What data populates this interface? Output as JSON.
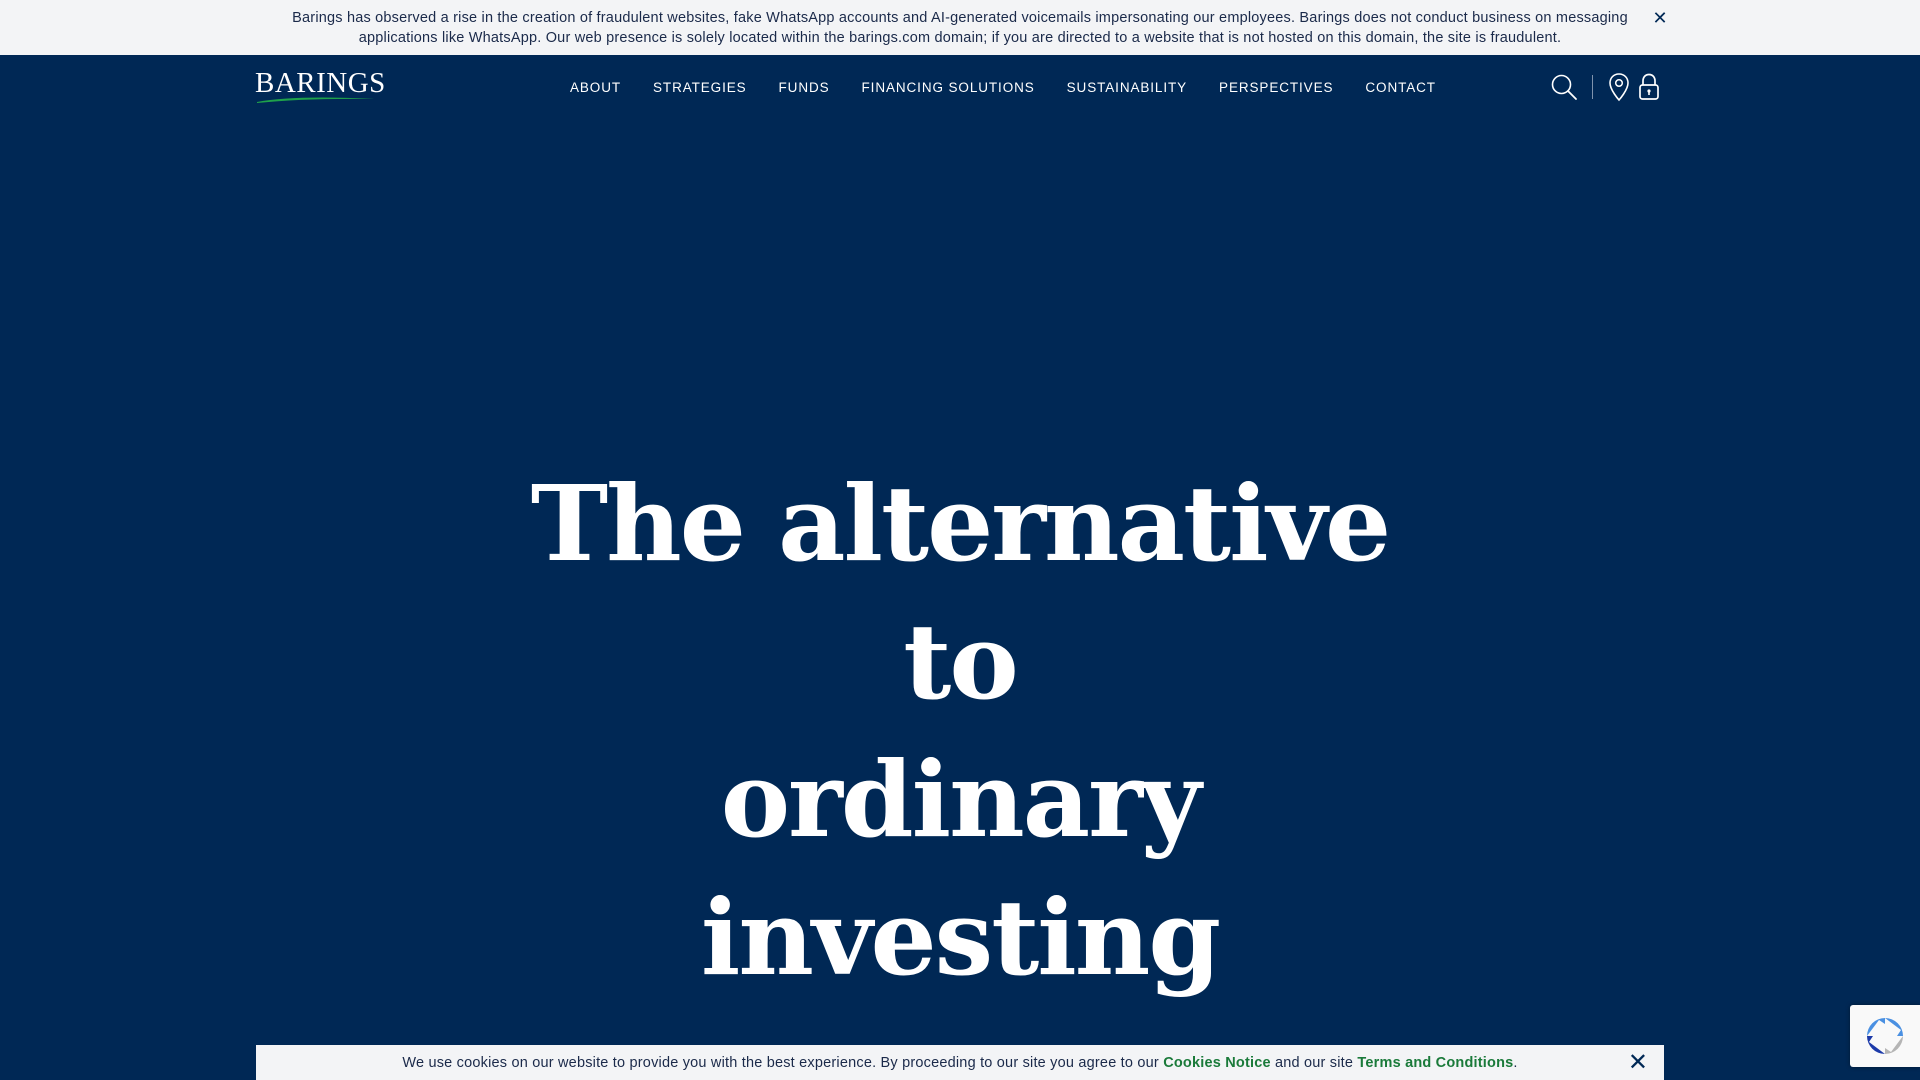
{
  "alert": {
    "message": "Barings has observed a rise in the creation of fraudulent websites, fake WhatsApp accounts and AI-generated voicemails impersonating our employees. Barings does not conduct business on messaging applications like WhatsApp. Our web presence is solely located within the barings.com domain; if you are directed to a website that is not hosted on this domain, the site is fraudulent.",
    "close_label": "✕"
  },
  "header": {
    "logo_text": "BARINGS",
    "nav": [
      "ABOUT",
      "STRATEGIES",
      "FUNDS",
      "FINANCING SOLUTIONS",
      "SUSTAINABILITY",
      "PERSPECTIVES",
      "CONTACT"
    ],
    "icons": [
      "search-icon",
      "location-pin-icon",
      "lock-icon"
    ]
  },
  "hero": {
    "title_line1": "The alternative to",
    "title_line2": "ordinary investing"
  },
  "cookie": {
    "text_before": "We use cookies on our website to provide you with the best experience. By proceeding to our site you agree to our ",
    "link1": "Cookies Notice",
    "text_middle": " and our site ",
    "link2": "Terms and Conditions",
    "text_after": ".",
    "close_label": "✕"
  },
  "colors": {
    "background": "#002855",
    "banner_bg": "#f3f4f6",
    "link_green": "#1a7a3a",
    "logo_swoosh": "#1fa24a"
  }
}
